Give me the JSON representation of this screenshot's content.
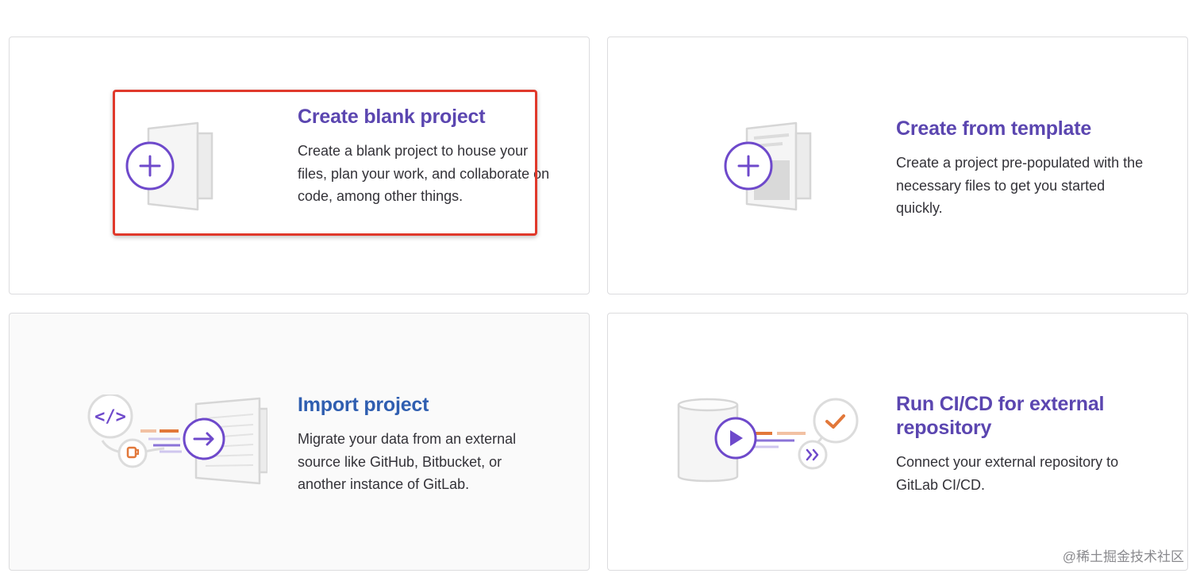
{
  "cards": {
    "blank": {
      "title": "Create blank project",
      "description": "Create a blank project to house your files, plan your work, and collaborate on code, among other things.",
      "icon": "new-document-plus-icon"
    },
    "template": {
      "title": "Create from template",
      "description": "Create a project pre-populated with the necessary files to get you started quickly.",
      "icon": "template-document-plus-icon"
    },
    "import": {
      "title": "Import project",
      "description": "Migrate your data from an external source like GitHub, Bitbucket, or another instance of GitLab.",
      "icon": "import-arrow-icon"
    },
    "cicd": {
      "title": "Run CI/CD for external repository",
      "description": "Connect your external repository to GitLab CI/CD.",
      "icon": "cicd-play-icon"
    }
  },
  "watermark": "@稀土掘金技术社区",
  "colors": {
    "title": "#5b46b0",
    "accent_purple": "#6e49cb",
    "accent_orange": "#e2783a",
    "highlight_border": "#e0392b",
    "card_border": "#dcdcde"
  }
}
